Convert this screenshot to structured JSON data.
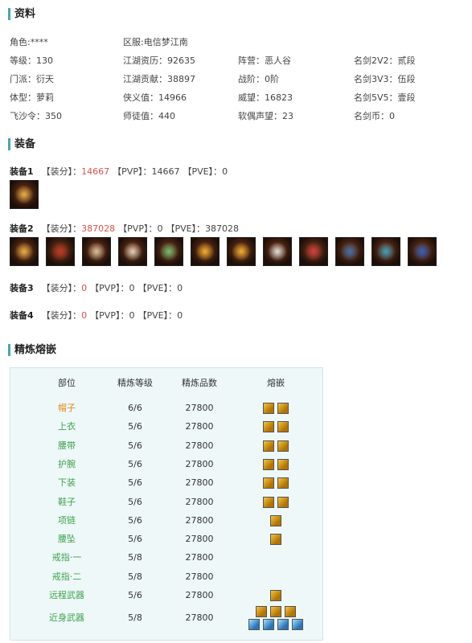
{
  "profile": {
    "title": "资料",
    "rows": [
      [
        "角色:****",
        "区服:电信梦江南",
        "",
        ""
      ],
      [
        "等级：130",
        "江湖资历：92635",
        "阵营：恶人谷",
        "名剑2V2：贰段"
      ],
      [
        "门派：衍天",
        "江湖贡献：38897",
        "战阶：0阶",
        "名剑3V3：伍段"
      ],
      [
        "体型：萝莉",
        "侠义值：14966",
        "威望：16823",
        "名剑5V5：壹段"
      ],
      [
        "飞沙令：350",
        "师徒值：440",
        "软偶声望：23",
        "名剑币：0"
      ]
    ]
  },
  "equipment": {
    "title": "装备",
    "sets": [
      {
        "name": "装备1",
        "score_label": "【装分】：",
        "score": "14667",
        "pvp_label": "【PVP】：",
        "pvp": "14667",
        "pve_label": "【PVE】：",
        "pve": "0",
        "icon_count": 1
      },
      {
        "name": "装备2",
        "score_label": "【装分】：",
        "score": "387028",
        "pvp_label": "【PVP】：",
        "pvp": "0",
        "pve_label": "【PVE】：",
        "pve": "387028",
        "icon_count": 12
      },
      {
        "name": "装备3",
        "score_label": "【装分】：",
        "score": "0",
        "pvp_label": "【PVP】：",
        "pvp": "0",
        "pve_label": "【PVE】：",
        "pve": "0",
        "icon_count": 0
      },
      {
        "name": "装备4",
        "score_label": "【装分】：",
        "score": "0",
        "pvp_label": "【PVP】：",
        "pvp": "0",
        "pve_label": "【PVE】：",
        "pve": "0",
        "icon_count": 0
      }
    ]
  },
  "refine": {
    "title": "精炼熔嵌",
    "headers": [
      "部位",
      "精炼等级",
      "精炼品数",
      "熔嵌"
    ],
    "rows": [
      {
        "part": "帽子",
        "level": "6/6",
        "quality": "27800",
        "gold": 2,
        "blue": 0
      },
      {
        "part": "上衣",
        "level": "5/6",
        "quality": "27800",
        "gold": 2,
        "blue": 0
      },
      {
        "part": "腰带",
        "level": "5/6",
        "quality": "27800",
        "gold": 2,
        "blue": 0
      },
      {
        "part": "护腕",
        "level": "5/6",
        "quality": "27800",
        "gold": 2,
        "blue": 0
      },
      {
        "part": "下装",
        "level": "5/6",
        "quality": "27800",
        "gold": 2,
        "blue": 0
      },
      {
        "part": "鞋子",
        "level": "5/6",
        "quality": "27800",
        "gold": 2,
        "blue": 0
      },
      {
        "part": "项链",
        "level": "5/6",
        "quality": "27800",
        "gold": 1,
        "blue": 0
      },
      {
        "part": "腰坠",
        "level": "5/6",
        "quality": "27800",
        "gold": 1,
        "blue": 0
      },
      {
        "part": "戒指·一",
        "level": "5/8",
        "quality": "27800",
        "gold": 0,
        "blue": 0
      },
      {
        "part": "戒指·二",
        "level": "5/8",
        "quality": "27800",
        "gold": 0,
        "blue": 0
      },
      {
        "part": "远程武器",
        "level": "5/6",
        "quality": "27800",
        "gold": 1,
        "blue": 0
      },
      {
        "part": "近身武器",
        "level": "5/8",
        "quality": "27800",
        "gold": 3,
        "blue": 4
      }
    ]
  }
}
